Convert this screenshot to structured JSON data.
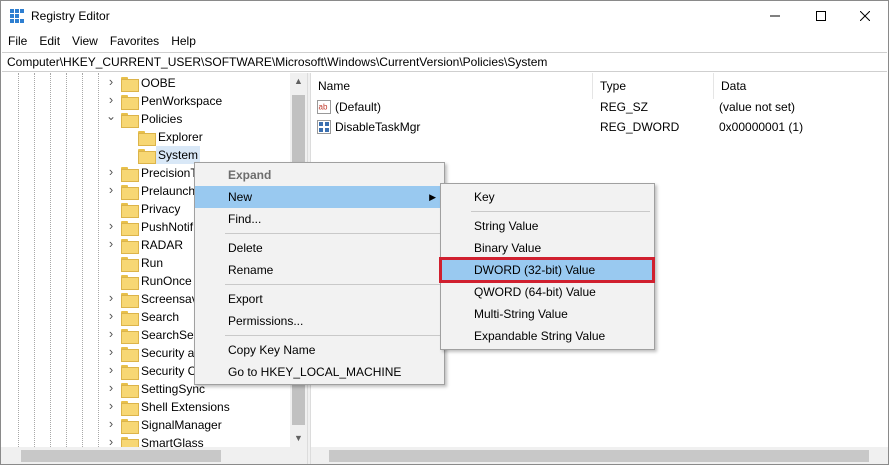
{
  "window": {
    "title": "Registry Editor",
    "accent": "#2e7fd1"
  },
  "menubar": [
    "File",
    "Edit",
    "View",
    "Favorites",
    "Help"
  ],
  "address": "Computer\\HKEY_CURRENT_USER\\SOFTWARE\\Microsoft\\Windows\\CurrentVersion\\Policies\\System",
  "tree": [
    {
      "label": "OOBE",
      "expand": "collapsed"
    },
    {
      "label": "PenWorkspace",
      "expand": "collapsed"
    },
    {
      "label": "Policies",
      "expand": "expanded"
    },
    {
      "label": "Explorer",
      "expand": "none"
    },
    {
      "label": "System",
      "expand": "none",
      "selected": true
    },
    {
      "label": "PrecisionT",
      "expand": "collapsed"
    },
    {
      "label": "Prelaunch",
      "expand": "collapsed"
    },
    {
      "label": "Privacy",
      "expand": "none"
    },
    {
      "label": "PushNotif",
      "expand": "collapsed"
    },
    {
      "label": "RADAR",
      "expand": "collapsed"
    },
    {
      "label": "Run",
      "expand": "none"
    },
    {
      "label": "RunOnce",
      "expand": "none"
    },
    {
      "label": "Screensav",
      "expand": "collapsed"
    },
    {
      "label": "Search",
      "expand": "collapsed"
    },
    {
      "label": "SearchSet",
      "expand": "collapsed"
    },
    {
      "label": "Security a",
      "expand": "collapsed"
    },
    {
      "label": "Security C",
      "expand": "collapsed"
    },
    {
      "label": "SettingSync",
      "expand": "collapsed"
    },
    {
      "label": "Shell Extensions",
      "expand": "collapsed"
    },
    {
      "label": "SignalManager",
      "expand": "collapsed"
    },
    {
      "label": "SmartGlass",
      "expand": "collapsed"
    }
  ],
  "values": {
    "columns": [
      "Name",
      "Type",
      "Data"
    ],
    "rows": [
      {
        "icon": "string-value-icon",
        "name": "(Default)",
        "type": "REG_SZ",
        "data": "(value not set)"
      },
      {
        "icon": "binary-value-icon",
        "name": "DisableTaskMgr",
        "type": "REG_DWORD",
        "data": "0x00000001 (1)"
      }
    ]
  },
  "context_menu": {
    "items": [
      {
        "label": "Expand",
        "disabled": true
      },
      {
        "label": "New",
        "submenu": true,
        "highlighted": true
      },
      {
        "label": "Find..."
      },
      {
        "separator": true
      },
      {
        "label": "Delete"
      },
      {
        "label": "Rename"
      },
      {
        "separator": true
      },
      {
        "label": "Export"
      },
      {
        "label": "Permissions..."
      },
      {
        "separator": true
      },
      {
        "label": "Copy Key Name"
      },
      {
        "label": "Go to HKEY_LOCAL_MACHINE"
      }
    ]
  },
  "new_submenu": {
    "items": [
      {
        "label": "Key"
      },
      {
        "separator": true
      },
      {
        "label": "String Value"
      },
      {
        "label": "Binary Value"
      },
      {
        "label": "DWORD (32-bit) Value",
        "highlighted": true,
        "annotated": true
      },
      {
        "label": "QWORD (64-bit) Value"
      },
      {
        "label": "Multi-String Value"
      },
      {
        "label": "Expandable String Value"
      }
    ]
  },
  "colors": {
    "highlight": "#99c9f0",
    "annotation": "#d0202f",
    "folder": "#f7d774"
  }
}
